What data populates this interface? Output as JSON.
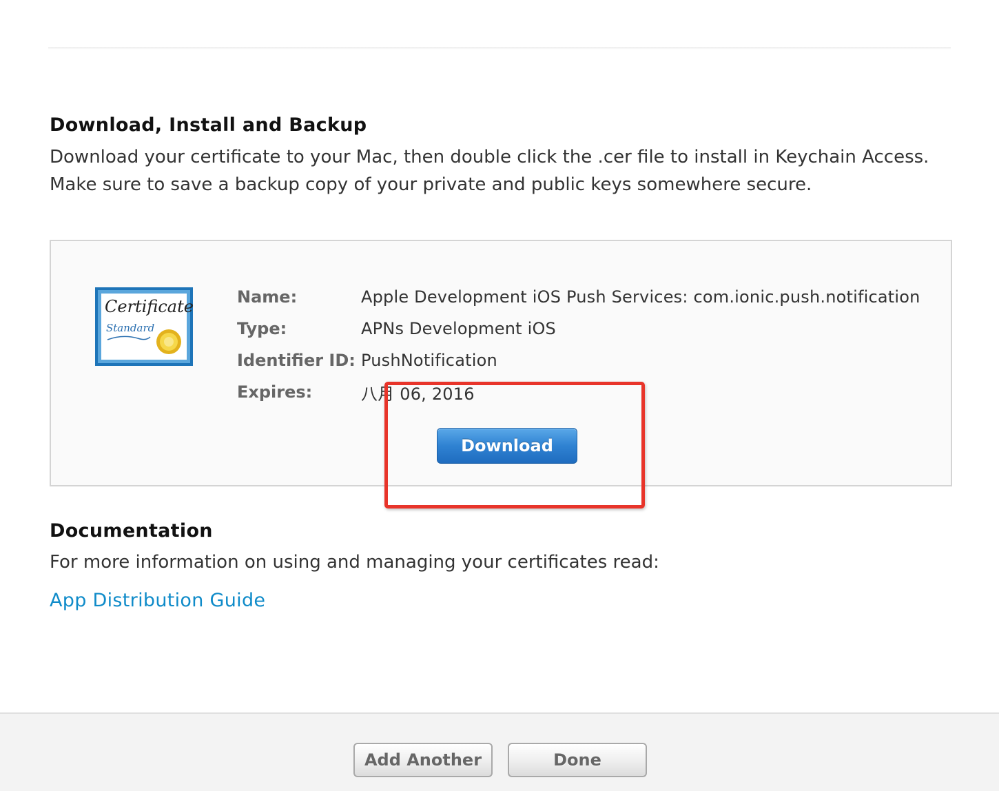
{
  "install_section": {
    "title": "Download, Install and Backup",
    "description": "Download your certificate to your Mac, then double click the .cer file to install in Keychain Access. Make sure to save a backup copy of your private and public keys somewhere secure."
  },
  "certificate": {
    "icon_text_line1": "Certificate",
    "icon_text_line2": "Standard",
    "name_label": "Name:",
    "name_value": "Apple Development iOS Push Services: com.ionic.push.notification",
    "type_label": "Type:",
    "type_value": "APNs Development iOS",
    "identifier_label": "Identifier ID:",
    "identifier_value": "PushNotification",
    "expires_label": "Expires:",
    "expires_value": "八月 06, 2016",
    "download_label": "Download"
  },
  "docs_section": {
    "title": "Documentation",
    "description": "For more information on using and managing your certificates read:",
    "link_label": "App Distribution Guide"
  },
  "footer": {
    "add_another_label": "Add Another",
    "done_label": "Done"
  },
  "colors": {
    "link": "#0f8bc9",
    "primary_button": "#2f82d2",
    "highlight": "#e8342a",
    "certificate_frame": "#1d74b8"
  }
}
